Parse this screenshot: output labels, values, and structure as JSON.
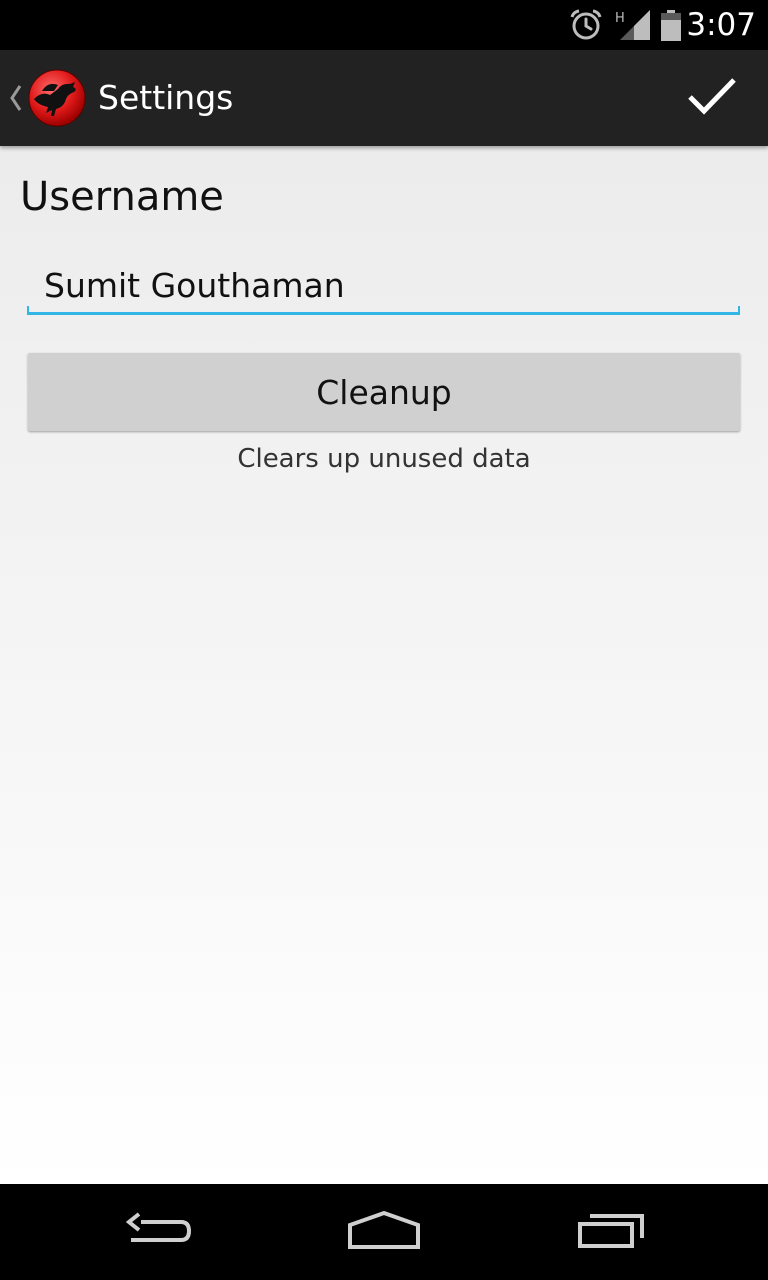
{
  "status_bar": {
    "time": "3:07",
    "icons": [
      "alarm-icon",
      "signal-icon",
      "battery-icon"
    ],
    "network_type": "H"
  },
  "action_bar": {
    "title": "Settings",
    "up_icon": "chevron-left-icon",
    "app_icon": "raven-logo-icon",
    "done_icon": "checkmark-icon",
    "background": "#222222"
  },
  "settings": {
    "username_label": "Username",
    "username_value": "Sumit Gouthaman",
    "cleanup_label": "Cleanup",
    "cleanup_hint": "Clears up unused data",
    "accent_color": "#33b5e5"
  },
  "nav_bar": {
    "icons": [
      "back-icon",
      "home-icon",
      "recent-apps-icon"
    ]
  }
}
